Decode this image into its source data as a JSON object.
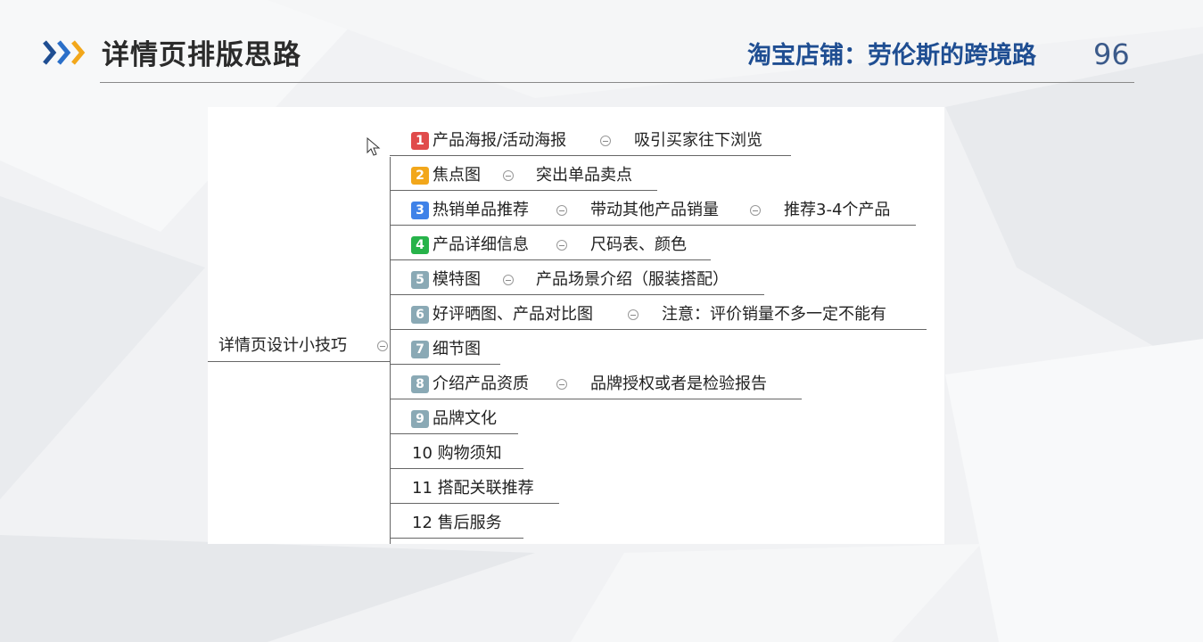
{
  "header": {
    "title": "详情页排版思路",
    "subtitle": "淘宝店铺：劳伦斯的跨境路",
    "page_number": "96"
  },
  "mindmap": {
    "root": "详情页设计小技巧",
    "badge_colors": {
      "1": "#e04b4b",
      "2": "#f2a71b",
      "3": "#3f82e8",
      "4": "#27b34a",
      "5": "#8aa9b5",
      "6": "#8aa9b5",
      "7": "#8aa9b5",
      "8": "#8aa9b5",
      "9": "#8aa9b5"
    },
    "branches": [
      {
        "num": "1",
        "label": "产品海报/活动海报",
        "detail1": "吸引买家往下浏览",
        "detail2": ""
      },
      {
        "num": "2",
        "label": "焦点图",
        "detail1": "突出单品卖点",
        "detail2": ""
      },
      {
        "num": "3",
        "label": "热销单品推荐",
        "detail1": "带动其他产品销量",
        "detail2": "推荐3-4个产品"
      },
      {
        "num": "4",
        "label": "产品详细信息",
        "detail1": "尺码表、颜色",
        "detail2": ""
      },
      {
        "num": "5",
        "label": "模特图",
        "detail1": "产品场景介绍（服装搭配）",
        "detail2": ""
      },
      {
        "num": "6",
        "label": "好评晒图、产品对比图",
        "detail1": "注意：评价销量不多一定不能有",
        "detail2": ""
      },
      {
        "num": "7",
        "label": "细节图",
        "detail1": "",
        "detail2": ""
      },
      {
        "num": "8",
        "label": "介绍产品资质",
        "detail1": "品牌授权或者是检验报告",
        "detail2": ""
      },
      {
        "num": "9",
        "label": "品牌文化",
        "detail1": "",
        "detail2": ""
      },
      {
        "num": "",
        "label": "10 购物须知",
        "detail1": "",
        "detail2": ""
      },
      {
        "num": "",
        "label": "11 搭配关联推荐",
        "detail1": "",
        "detail2": ""
      },
      {
        "num": "",
        "label": "12 售后服务",
        "detail1": "",
        "detail2": ""
      }
    ]
  }
}
